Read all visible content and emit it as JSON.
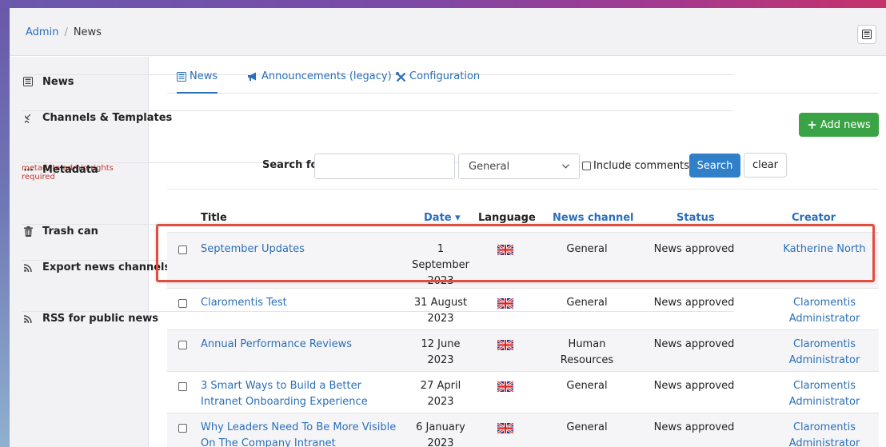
{
  "breadcrumb": {
    "root": "Admin",
    "separator": "/",
    "current": "News"
  },
  "header": {
    "toggle_icon": "newspaper-icon"
  },
  "sidebar": {
    "items": [
      {
        "label": "News",
        "icon": "newspaper-icon"
      },
      {
        "label": "Channels & Templates",
        "icon": "satellite-dish-icon"
      },
      {
        "label": "Metadata",
        "icon": "ellipsis-icon",
        "note": "metadata admin rights required"
      },
      {
        "label": "Trash can",
        "icon": "trash-icon"
      },
      {
        "label": "Export news channels as RSS",
        "icon": "rss-icon"
      },
      {
        "label": "RSS for public news",
        "icon": "rss-icon"
      }
    ]
  },
  "tabs": [
    {
      "label": "News",
      "icon": "newspaper-icon",
      "active": true
    },
    {
      "label": "Announcements (legacy)",
      "icon": "megaphone-icon"
    },
    {
      "label": "Configuration",
      "icon": "tools-icon"
    }
  ],
  "add_news_label": "Add news",
  "search": {
    "label": "Search for",
    "value": "",
    "placeholder": "",
    "channel_selected": "General",
    "include_comments_label": "Include comments",
    "search_button": "Search",
    "clear_button": "clear"
  },
  "table": {
    "columns": [
      "Title",
      "Date",
      "Language",
      "News channel",
      "Status",
      "Creator"
    ],
    "sort_indicator": "▾",
    "rows": [
      {
        "title": "September Updates",
        "date": "1 September 2023",
        "channel": "General",
        "status": "News approved",
        "creator": "Katherine North"
      },
      {
        "title": "Claromentis Test",
        "date": "31 August 2023",
        "channel": "General",
        "status": "News approved",
        "creator": "Claromentis Administrator"
      },
      {
        "title": "Annual Performance Reviews",
        "date": "12 June 2023",
        "channel": "Human Resources",
        "status": "News approved",
        "creator": "Claromentis Administrator"
      },
      {
        "title": "3 Smart Ways to Build a Better Intranet Onboarding Experience",
        "date": "27 April 2023",
        "channel": "General",
        "status": "News approved",
        "creator": "Claromentis Administrator"
      },
      {
        "title": "Why Leaders Need To Be More Visible On The Company Intranet",
        "date": "6 January 2023",
        "channel": "General",
        "status": "News approved",
        "creator": "Claromentis Administrator"
      }
    ]
  },
  "colors": {
    "link": "#2a6fb8",
    "add_button": "#3aa346",
    "search_button": "#2f7fc9",
    "highlight": "#e14d3f",
    "warning_note": "#c0392b"
  }
}
